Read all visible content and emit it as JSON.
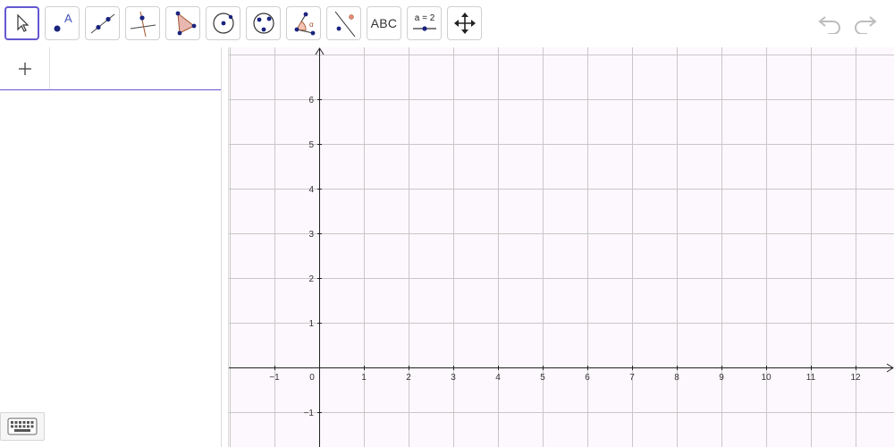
{
  "toolbar": {
    "tools": [
      {
        "name": "move-tool",
        "label": "",
        "selected": true
      },
      {
        "name": "point-tool",
        "label": "A"
      },
      {
        "name": "line-tool",
        "label": ""
      },
      {
        "name": "perpendicular-line-tool",
        "label": ""
      },
      {
        "name": "polygon-tool",
        "label": ""
      },
      {
        "name": "circle-center-point-tool",
        "label": ""
      },
      {
        "name": "circle-through-3-points-tool",
        "label": ""
      },
      {
        "name": "angle-tool",
        "label": "α"
      },
      {
        "name": "reflect-about-line-tool",
        "label": ""
      },
      {
        "name": "text-tool",
        "label": "ABC"
      },
      {
        "name": "slider-tool",
        "label": "a = 2"
      },
      {
        "name": "move-graphics-view-tool",
        "label": ""
      }
    ],
    "undo_icon": "undo-icon",
    "redo_icon": "redo-icon"
  },
  "algebra": {
    "add_label": "+",
    "input_value": "",
    "keyboard_icon": "keyboard-icon"
  },
  "graphics": {
    "x_ticks": [
      "−1",
      "0",
      "1",
      "2",
      "3",
      "4",
      "5",
      "6",
      "7",
      "8",
      "9",
      "10",
      "11",
      "12"
    ],
    "y_ticks": [
      "6",
      "5",
      "4",
      "3",
      "2",
      "1",
      "−1"
    ]
  },
  "colors": {
    "accent": "#6557d2",
    "grid": "#c8c8c8",
    "axes": "#222222",
    "canvas": "#fdf8fd"
  }
}
